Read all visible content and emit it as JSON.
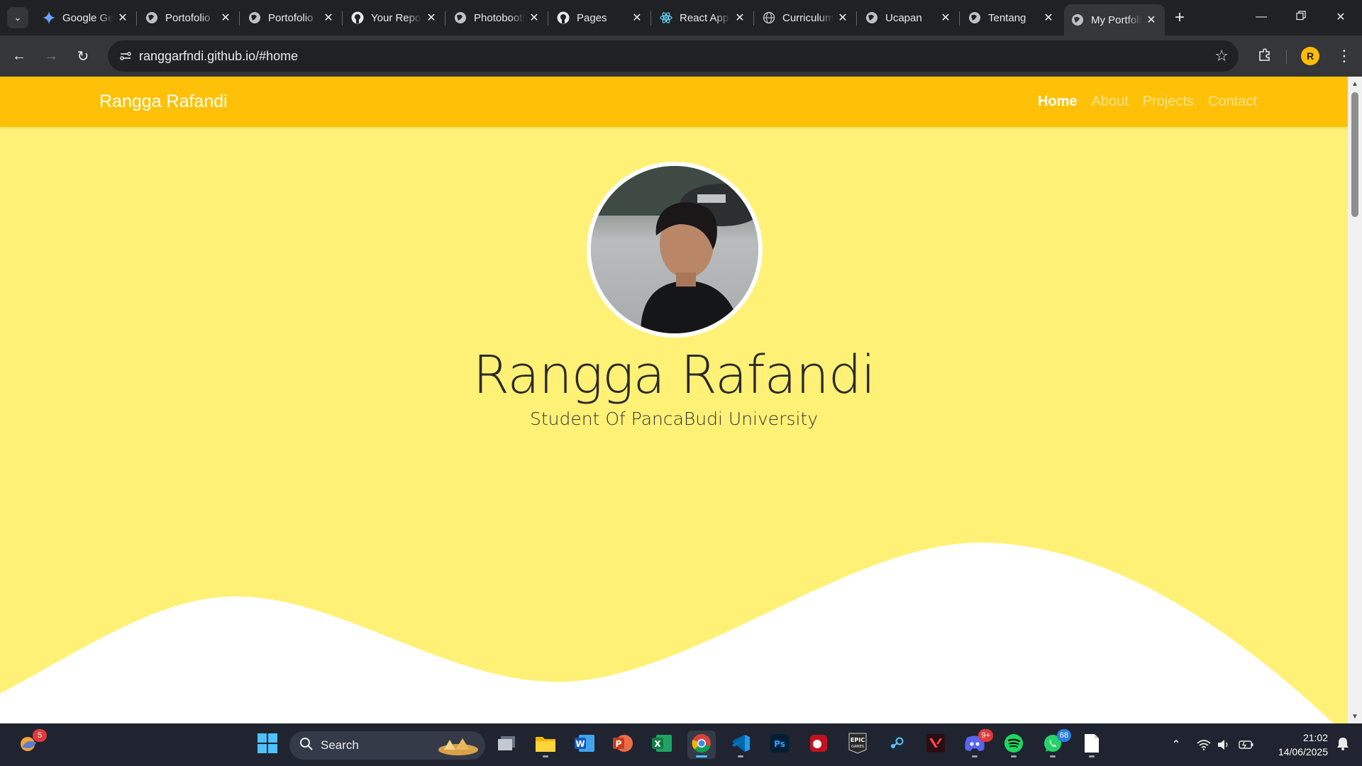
{
  "browser": {
    "tabs": [
      {
        "title": "Google Gemini",
        "icon": "gemini-icon"
      },
      {
        "title": "Portofolio",
        "icon": "globe-icon"
      },
      {
        "title": "Portofolio",
        "icon": "globe-icon"
      },
      {
        "title": "Your Repositories",
        "icon": "github-icon"
      },
      {
        "title": "Photobooth",
        "icon": "globe-icon"
      },
      {
        "title": "Pages",
        "icon": "github-icon"
      },
      {
        "title": "React App",
        "icon": "react-icon"
      },
      {
        "title": "Curriculum",
        "icon": "globe-outline-icon"
      },
      {
        "title": "Ucapan",
        "icon": "globe-icon"
      },
      {
        "title": "Tentang",
        "icon": "globe-icon"
      },
      {
        "title": "My Portfolio",
        "icon": "globe-icon",
        "active": true
      }
    ],
    "url": "ranggarfndi.github.io/#home",
    "profile_initial": "R"
  },
  "page": {
    "navbar": {
      "brand": "Rangga Rafandi",
      "links": [
        "Home",
        "About",
        "Projects",
        "Contact"
      ],
      "active": "Home"
    },
    "hero": {
      "name": "Rangga Rafandi",
      "subtitle": "Student Of PancaBudi University"
    }
  },
  "colors": {
    "navbar": "#ffc107",
    "hero_bg": "#fff176",
    "wave": "#ffffff"
  },
  "taskbar": {
    "search_label": "Search",
    "weather_badge": "5",
    "discord_badge": "9+",
    "whatsapp_badge": "68",
    "apps": [
      "windows-start-icon",
      "task-view-icon",
      "file-explorer-icon",
      "word-icon",
      "powerpoint-icon",
      "excel-icon",
      "chrome-icon",
      "vscode-icon",
      "photoshop-icon",
      "app-red-icon",
      "epic-games-icon",
      "steam-icon",
      "valorant-icon",
      "discord-icon",
      "spotify-icon",
      "whatsapp-icon",
      "notepad-icon"
    ],
    "time": "21:02",
    "date": "14/06/2025"
  }
}
